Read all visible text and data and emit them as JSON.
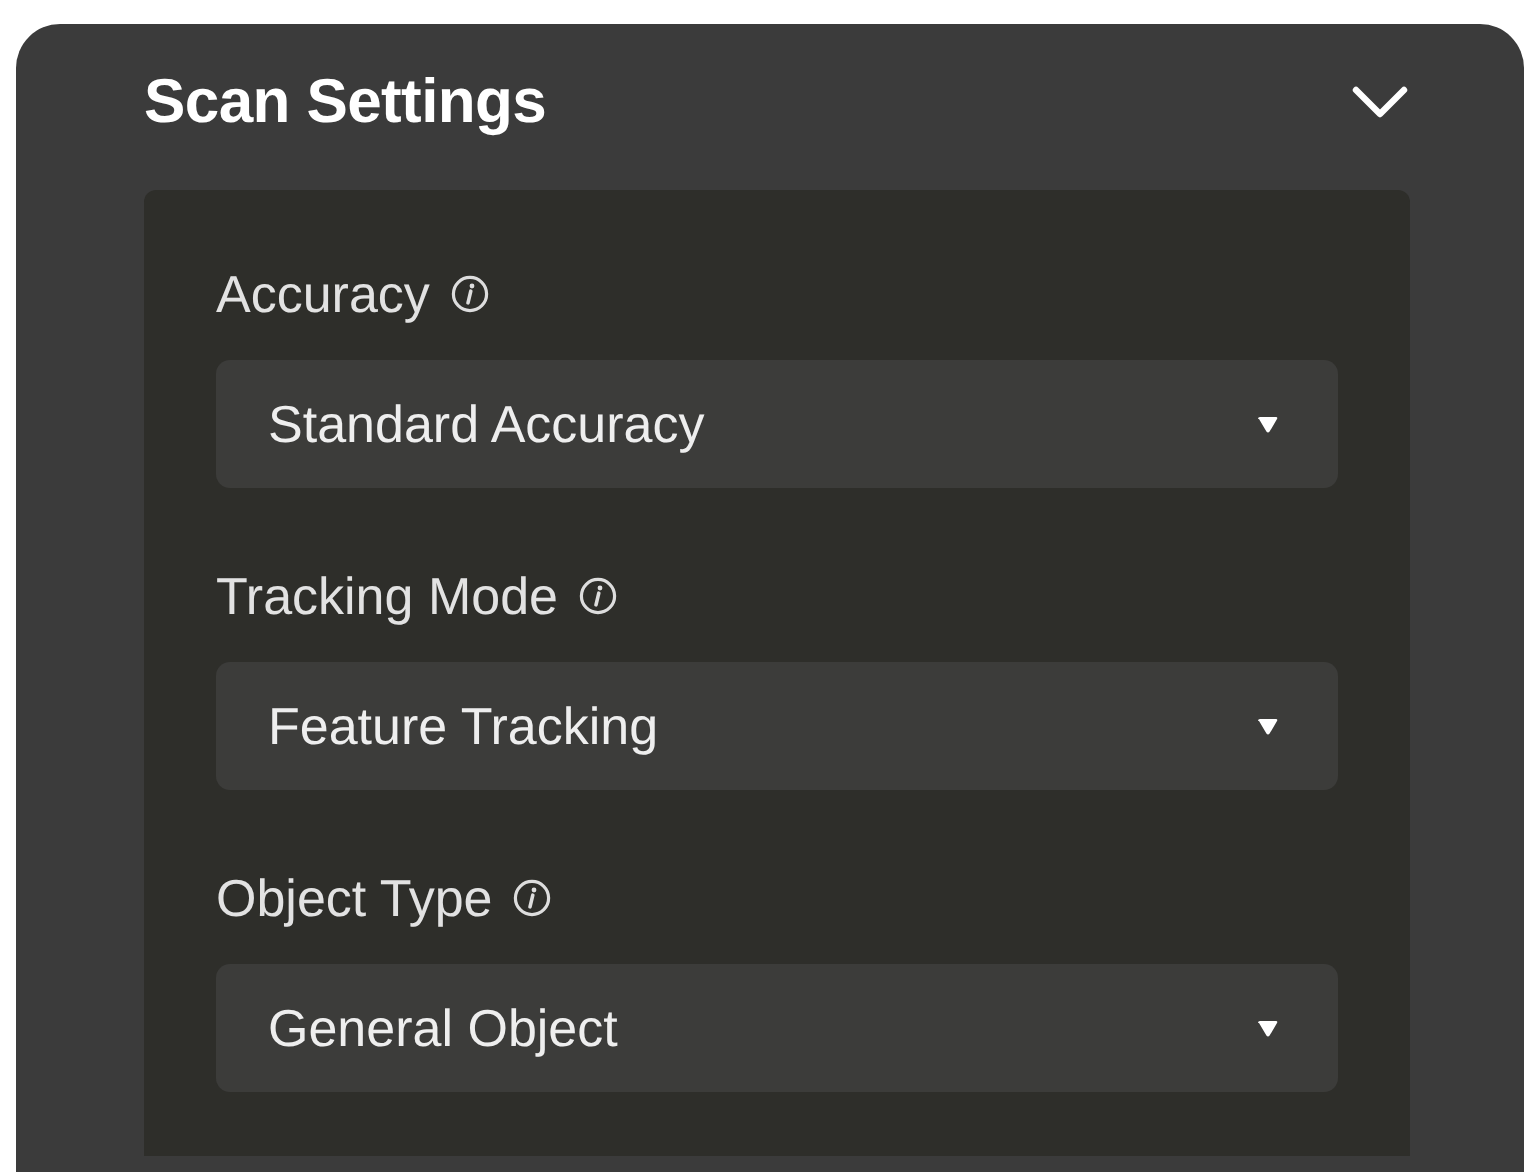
{
  "panel": {
    "title": "Scan Settings",
    "expanded": true
  },
  "fields": [
    {
      "label": "Accuracy",
      "value": "Standard Accuracy"
    },
    {
      "label": "Tracking Mode",
      "value": "Feature Tracking"
    },
    {
      "label": "Object Type",
      "value": "General Object"
    }
  ]
}
